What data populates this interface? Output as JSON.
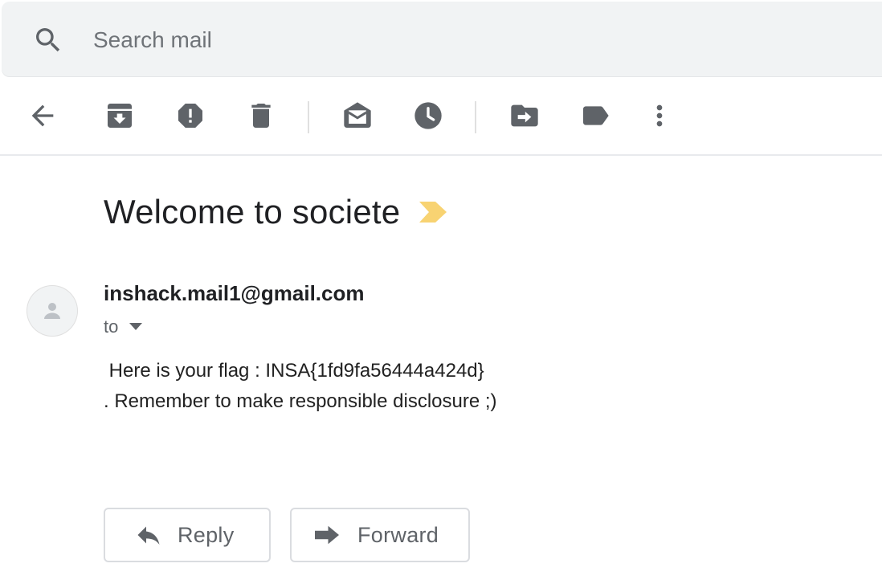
{
  "search": {
    "placeholder": "Search mail"
  },
  "toolbar": {
    "icons": [
      "back-arrow-icon",
      "archive-icon",
      "report-spam-icon",
      "delete-icon",
      "mark-unread-icon",
      "snooze-icon",
      "move-to-icon",
      "labels-icon",
      "more-vert-icon"
    ]
  },
  "message": {
    "subject": "Welcome to societe",
    "sender": "inshack.mail1@gmail.com",
    "to_label": "to",
    "body": [
      " Here is your flag : INSA{1fd9fa56444a424d}",
      ". Remember to make responsible disclosure ;)"
    ]
  },
  "actions": {
    "reply_label": "Reply",
    "forward_label": "Forward"
  },
  "colors": {
    "icon_gray": "#5f6368",
    "important_marker": "#f8d372",
    "search_bg": "#f1f3f4"
  }
}
